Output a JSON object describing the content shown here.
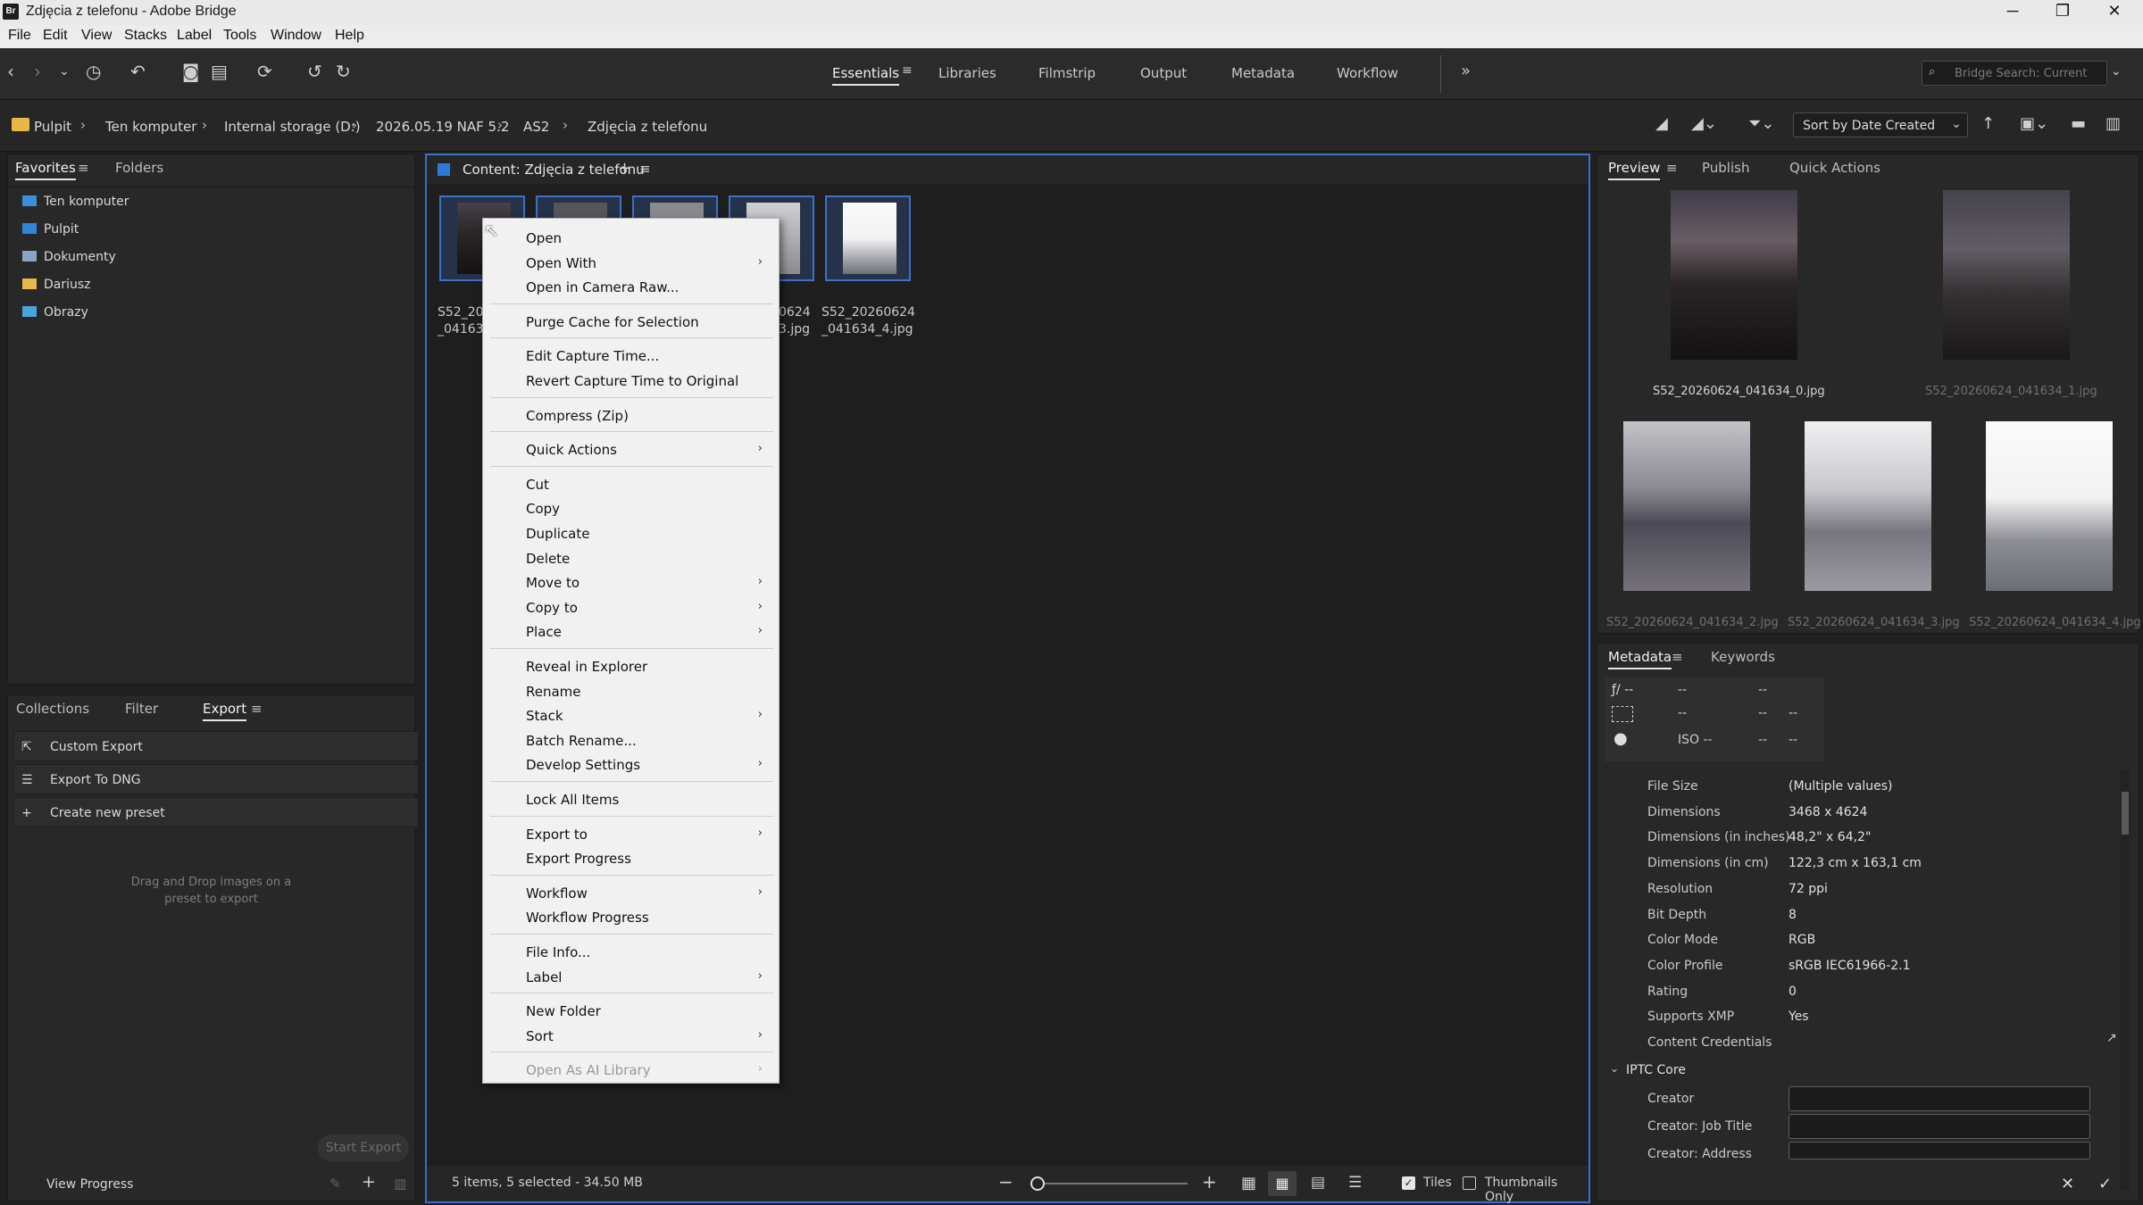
{
  "window": {
    "title": "Zdjęcia z telefonu - Adobe Bridge",
    "logo": "Br",
    "controls": [
      "─",
      "❐",
      "✕"
    ]
  },
  "menu": [
    "File",
    "Edit",
    "View",
    "Stacks",
    "Label",
    "Tools",
    "Window",
    "Help"
  ],
  "workspaces": [
    "Essentials",
    "Libraries",
    "Filmstrip",
    "Output",
    "Metadata",
    "Workflow"
  ],
  "search": {
    "placeholder": "Bridge Search: Current"
  },
  "breadcrumb": [
    "Pulpit",
    "Ten komputer",
    "Internal storage (D:)",
    "2026.05.19 NAF 5.2",
    "AS2",
    "Zdjęcia z telefonu"
  ],
  "sort": {
    "label": "Sort by Date Created"
  },
  "left_tabs": {
    "favorites": "Favorites",
    "folders": "Folders"
  },
  "favorites": [
    {
      "label": "Ten komputer",
      "color": "#3a8fd6"
    },
    {
      "label": "Pulpit",
      "color": "#2f86d9"
    },
    {
      "label": "Dokumenty",
      "color": "#8aa4c4"
    },
    {
      "label": "Dariusz",
      "color": "#e7b84a"
    },
    {
      "label": "Obrazy",
      "color": "#48a3de"
    }
  ],
  "lower_tabs": {
    "collections": "Collections",
    "filter": "Filter",
    "export": "Export"
  },
  "export": {
    "items": [
      "Custom Export",
      "Export To DNG",
      "Create new preset"
    ],
    "hint_line1": "Drag and Drop images on a",
    "hint_line2": "preset to export",
    "start": "Start Export",
    "progress": "View Progress"
  },
  "content": {
    "tab": "Content: Zdjęcia z telefonu",
    "visible_names": [
      {
        "l1": "S52_202",
        "l2": "_041634"
      },
      {
        "l1": "0624",
        "l2": "3.jpg"
      },
      {
        "l1": "S52_20260624",
        "l2": "_041634_4.jpg"
      }
    ]
  },
  "context_menu": [
    {
      "label": "Open"
    },
    {
      "label": "Open With",
      "sub": true
    },
    {
      "label": "Open in Camera Raw..."
    },
    {
      "sep": true
    },
    {
      "label": "Purge Cache for Selection"
    },
    {
      "sep": true
    },
    {
      "label": "Edit Capture Time..."
    },
    {
      "label": "Revert Capture Time to Original"
    },
    {
      "sep": true
    },
    {
      "label": "Compress (Zip)"
    },
    {
      "sep": true
    },
    {
      "label": "Quick Actions",
      "sub": true
    },
    {
      "sep": true
    },
    {
      "label": "Cut"
    },
    {
      "label": "Copy"
    },
    {
      "label": "Duplicate"
    },
    {
      "label": "Delete"
    },
    {
      "label": "Move to",
      "sub": true
    },
    {
      "label": "Copy to",
      "sub": true
    },
    {
      "label": "Place",
      "sub": true
    },
    {
      "sep": true
    },
    {
      "label": "Reveal in Explorer"
    },
    {
      "label": "Rename"
    },
    {
      "label": "Stack",
      "sub": true
    },
    {
      "label": "Batch Rename..."
    },
    {
      "label": "Develop Settings",
      "sub": true
    },
    {
      "sep": true
    },
    {
      "label": "Lock All Items"
    },
    {
      "sep": true
    },
    {
      "label": "Export to",
      "sub": true
    },
    {
      "label": "Export Progress"
    },
    {
      "sep": true
    },
    {
      "label": "Workflow",
      "sub": true
    },
    {
      "label": "Workflow Progress"
    },
    {
      "sep": true
    },
    {
      "label": "File Info..."
    },
    {
      "label": "Label",
      "sub": true
    },
    {
      "sep": true
    },
    {
      "label": "New Folder"
    },
    {
      "label": "Sort",
      "sub": true
    },
    {
      "sep": true
    },
    {
      "label": "Open As AI Library",
      "sub": true,
      "disabled": true
    }
  ],
  "preview": {
    "tabs": [
      "Preview",
      "Publish",
      "Quick Actions"
    ],
    "names": [
      "S52_20260624_041634_0.jpg",
      "S52_20260624_041634_1.jpg",
      "S52_20260624_041634_2.jpg",
      "S52_20260624_041634_3.jpg",
      "S52_20260624_041634_4.jpg"
    ]
  },
  "metadata": {
    "tabs": [
      "Metadata",
      "Keywords"
    ],
    "camera": {
      "aperture": "ƒ/ --",
      "a1": "--",
      "a2": "--",
      "b1": "--",
      "b2": "--",
      "b3": "--",
      "iso": "ISO --",
      "c2": "--",
      "c3": "--"
    },
    "rows": [
      {
        "k": "File Size",
        "v": "(Multiple values)"
      },
      {
        "k": "Dimensions",
        "v": "3468 x 4624"
      },
      {
        "k": "Dimensions (in inches)",
        "v": "48,2\" x 64,2\""
      },
      {
        "k": "Dimensions (in cm)",
        "v": "122,3 cm x 163,1 cm"
      },
      {
        "k": "Resolution",
        "v": "72 ppi"
      },
      {
        "k": "Bit Depth",
        "v": "8"
      },
      {
        "k": "Color Mode",
        "v": "RGB"
      },
      {
        "k": "Color Profile",
        "v": "sRGB IEC61966-2.1"
      },
      {
        "k": "Rating",
        "v": "0"
      },
      {
        "k": "Supports XMP",
        "v": "Yes"
      },
      {
        "k": "Content Credentials",
        "v": ""
      }
    ],
    "iptc": "IPTC Core",
    "iptc_rows": [
      "Creator",
      "Creator: Job Title",
      "Creator: Address"
    ]
  },
  "status": {
    "text": "5 items, 5 selected - 34.50 MB",
    "tiles": "Tiles",
    "thumbs_only": "Thumbnails Only"
  }
}
